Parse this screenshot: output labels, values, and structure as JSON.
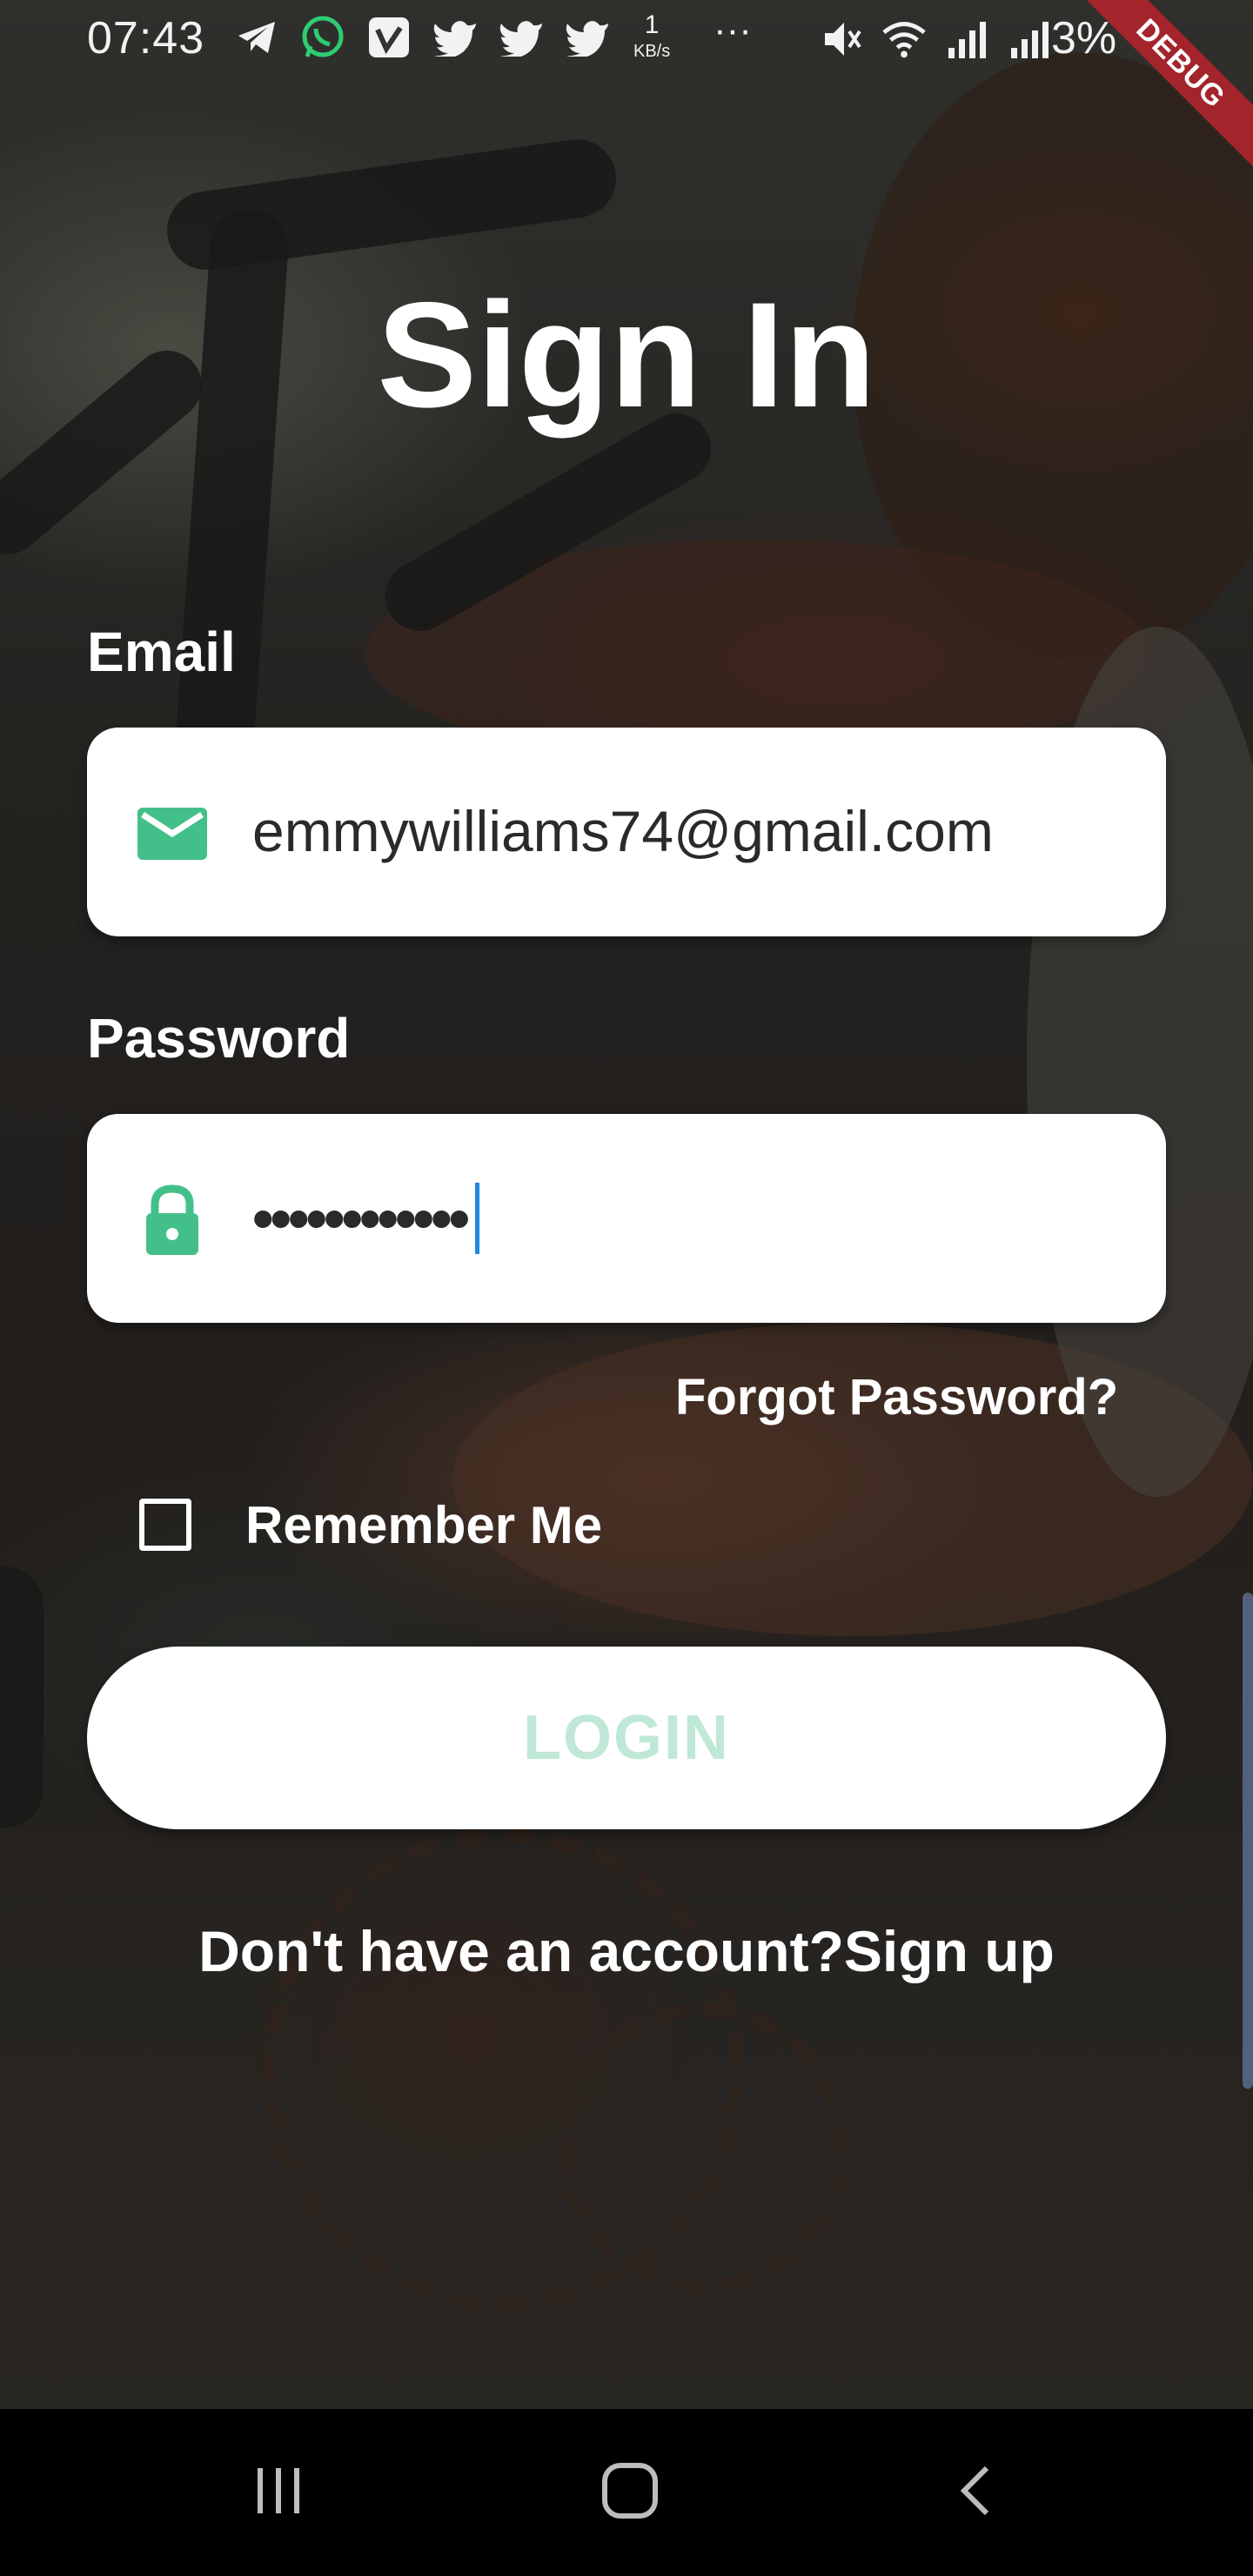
{
  "status_bar": {
    "time": "07:43",
    "speed_value": "1",
    "speed_unit": "KB/s",
    "more": "···",
    "battery": "3%",
    "icons_left": [
      "telegram-icon",
      "whatsapp-icon",
      "vimeo-icon",
      "twitter-icon",
      "twitter-icon",
      "twitter-icon"
    ],
    "icons_right": [
      "mute-icon",
      "wifi-icon",
      "signal-icon",
      "signal-icon"
    ]
  },
  "debug_banner": "DEBUG",
  "title": "Sign In",
  "email": {
    "label": "Email",
    "value": "emmywilliams74@gmail.com",
    "icon": "mail-icon"
  },
  "password": {
    "label": "Password",
    "value": "••••••••••••",
    "icon": "lock-icon"
  },
  "forgot_password": "Forgot Password?",
  "remember_me": {
    "label": "Remember Me",
    "checked": false
  },
  "login_button": "LOGIN",
  "signup": {
    "prompt": "Don't have an account?",
    "link": "Sign up"
  },
  "nav_bar": {
    "buttons": [
      "recents-icon",
      "home-icon",
      "back-icon"
    ]
  },
  "colors": {
    "accent": "#43c08a",
    "login_text": "#bfe8d6",
    "caret": "#1f87e5",
    "debug": "#a3242b"
  }
}
